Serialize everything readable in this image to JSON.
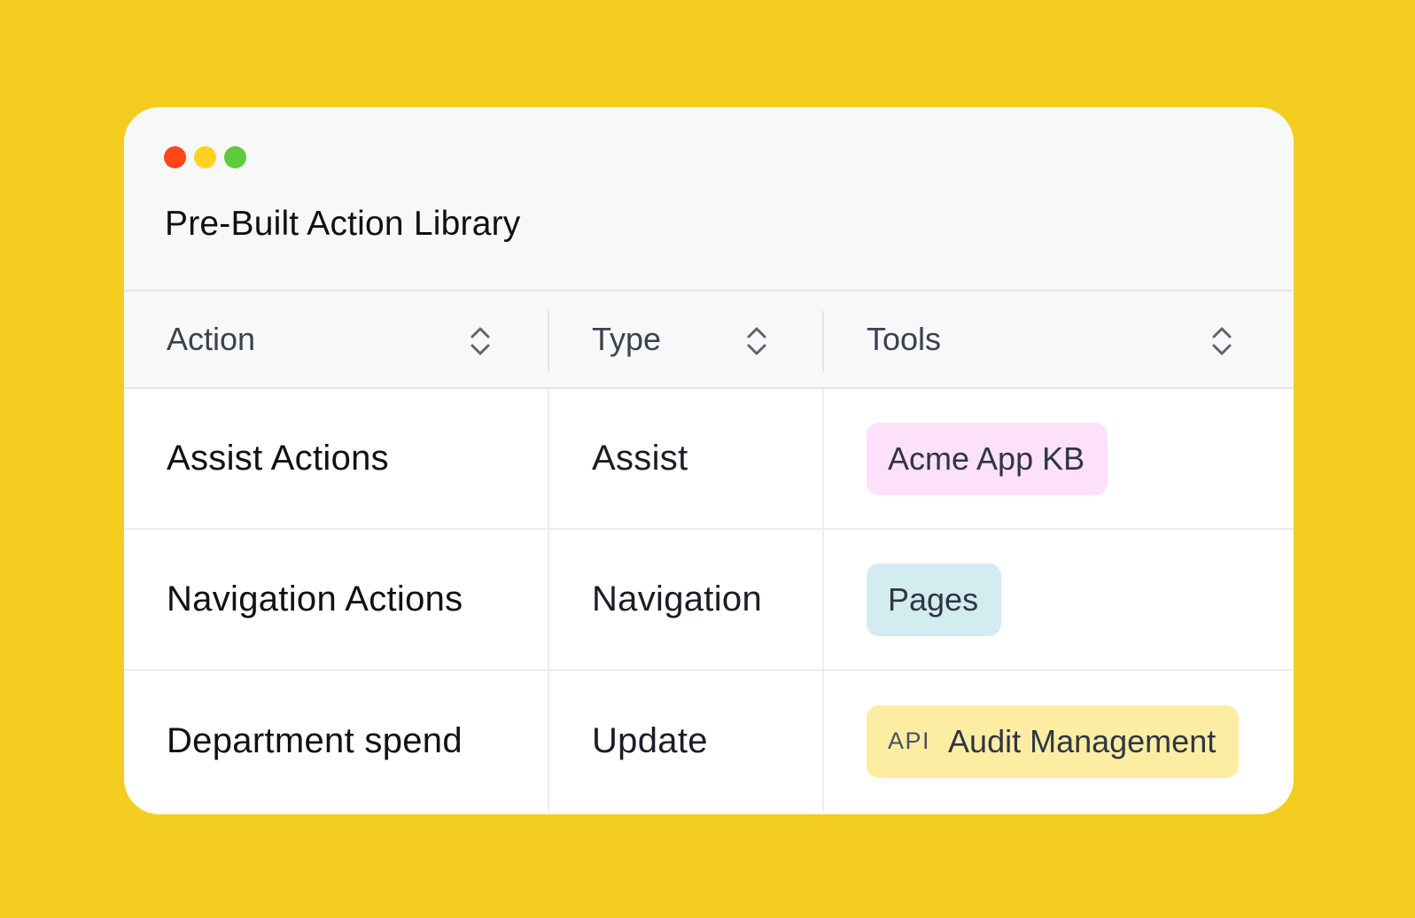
{
  "colors": {
    "background": "#F4CD21",
    "dot_close": "#FF4717",
    "dot_minimize": "#FFD21F",
    "dot_maximize": "#5ECB3A",
    "tag_pink": "#FDE0FA",
    "tag_teal": "#D3ECEF",
    "tag_yellow": "#FDEDA3"
  },
  "window": {
    "title": "Pre-Built Action Library"
  },
  "table": {
    "columns": [
      {
        "label": "Action",
        "icon": "sort-icon"
      },
      {
        "label": "Type",
        "icon": "sort-icon"
      },
      {
        "label": "Tools",
        "icon": "sort-icon"
      }
    ],
    "rows": [
      {
        "action": "Assist Actions",
        "type": "Assist",
        "tool": {
          "prefix": "",
          "label": "Acme App KB",
          "color": "pink"
        }
      },
      {
        "action": "Navigation Actions",
        "type": "Navigation",
        "tool": {
          "prefix": "",
          "label": "Pages",
          "color": "teal"
        }
      },
      {
        "action": "Department spend",
        "type": "Update",
        "tool": {
          "prefix": "API",
          "label": "Audit Management",
          "color": "yellow"
        }
      }
    ]
  }
}
